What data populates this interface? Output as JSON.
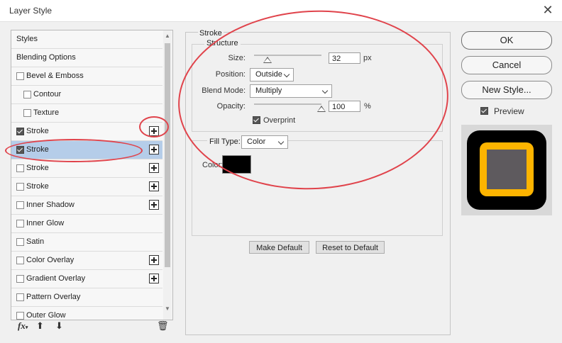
{
  "window": {
    "title": "Layer Style",
    "close_glyph": "✕"
  },
  "styles_list": {
    "items": [
      {
        "label": "Styles",
        "checkbox": false,
        "checked": false,
        "plus": false,
        "indent": 0,
        "selected": false
      },
      {
        "label": "Blending Options",
        "checkbox": false,
        "checked": false,
        "plus": false,
        "indent": 0,
        "selected": false
      },
      {
        "label": "Bevel & Emboss",
        "checkbox": true,
        "checked": false,
        "plus": false,
        "indent": 0,
        "selected": false
      },
      {
        "label": "Contour",
        "checkbox": true,
        "checked": false,
        "plus": false,
        "indent": 1,
        "selected": false
      },
      {
        "label": "Texture",
        "checkbox": true,
        "checked": false,
        "plus": false,
        "indent": 1,
        "selected": false
      },
      {
        "label": "Stroke",
        "checkbox": true,
        "checked": true,
        "plus": true,
        "indent": 0,
        "selected": false
      },
      {
        "label": "Stroke",
        "checkbox": true,
        "checked": true,
        "plus": true,
        "indent": 0,
        "selected": true
      },
      {
        "label": "Stroke",
        "checkbox": true,
        "checked": false,
        "plus": true,
        "indent": 0,
        "selected": false
      },
      {
        "label": "Stroke",
        "checkbox": true,
        "checked": false,
        "plus": true,
        "indent": 0,
        "selected": false
      },
      {
        "label": "Inner Shadow",
        "checkbox": true,
        "checked": false,
        "plus": true,
        "indent": 0,
        "selected": false
      },
      {
        "label": "Inner Glow",
        "checkbox": true,
        "checked": false,
        "plus": false,
        "indent": 0,
        "selected": false
      },
      {
        "label": "Satin",
        "checkbox": true,
        "checked": false,
        "plus": false,
        "indent": 0,
        "selected": false
      },
      {
        "label": "Color Overlay",
        "checkbox": true,
        "checked": false,
        "plus": true,
        "indent": 0,
        "selected": false
      },
      {
        "label": "Gradient Overlay",
        "checkbox": true,
        "checked": false,
        "plus": true,
        "indent": 0,
        "selected": false
      },
      {
        "label": "Pattern Overlay",
        "checkbox": true,
        "checked": false,
        "plus": false,
        "indent": 0,
        "selected": false
      },
      {
        "label": "Outer Glow",
        "checkbox": true,
        "checked": false,
        "plus": false,
        "indent": 0,
        "selected": false
      }
    ],
    "toolbar": {
      "fx": "fx",
      "fx_arrow": "▾",
      "up": "⬆",
      "down": "⬇",
      "trash": "🗑"
    }
  },
  "stroke": {
    "title": "Stroke",
    "structure_title": "Structure",
    "size_label": "Size:",
    "size_value": "32",
    "size_unit": "px",
    "size_fraction": 0.2,
    "position_label": "Position:",
    "position_value": "Outside",
    "blend_label": "Blend Mode:",
    "blend_value": "Multiply",
    "opacity_label": "Opacity:",
    "opacity_value": "100",
    "opacity_unit": "%",
    "opacity_fraction": 1.0,
    "overprint_label": "Overprint",
    "overprint_checked": true,
    "fill_type_label": "Fill Type:",
    "fill_type_value": "Color",
    "color_label": "Color:",
    "color_value": "#000000"
  },
  "buttons": {
    "make_default": "Make Default",
    "reset_default": "Reset to Default",
    "ok": "OK",
    "cancel": "Cancel",
    "new_style": "New Style...",
    "preview_label": "Preview",
    "preview_checked": true
  },
  "colors": {
    "selection": "#b5cde9",
    "annotation": "#e0434b",
    "preview_stroke": "#fdb400",
    "preview_fill": "#5e5a5e",
    "preview_outer": "#000000"
  }
}
